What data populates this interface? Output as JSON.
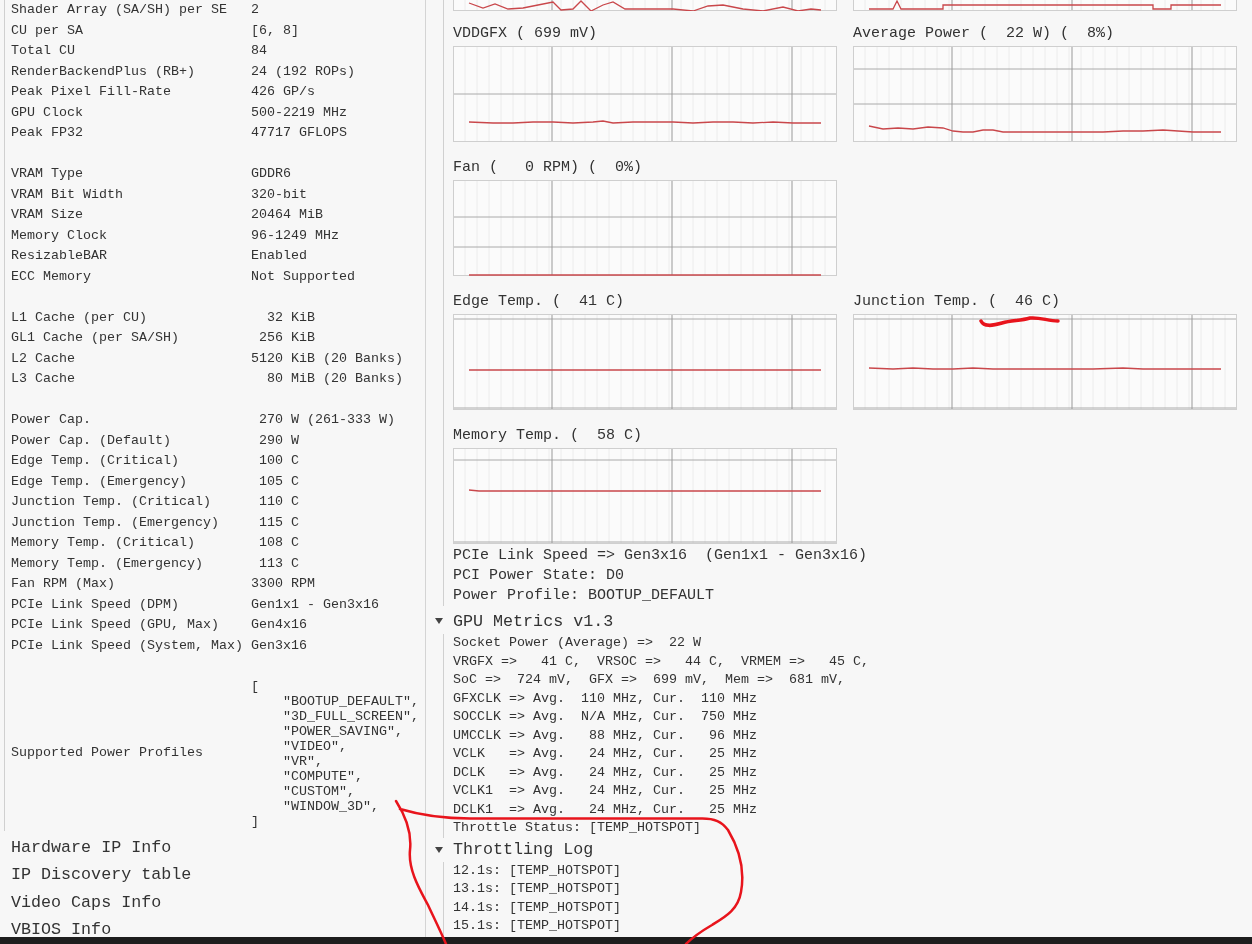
{
  "left_panel": {
    "groups": [
      [
        {
          "label": "Shader Array (SA/SH) per SE",
          "value": "2"
        },
        {
          "label": "CU per SA",
          "value": "[6, 8]"
        },
        {
          "label": "Total CU",
          "value": "84"
        },
        {
          "label": "RenderBackendPlus (RB+)",
          "value": "24 (192 ROPs)"
        },
        {
          "label": "Peak Pixel Fill-Rate",
          "value": "426 GP/s"
        },
        {
          "label": "GPU Clock",
          "value": "500-2219 MHz"
        },
        {
          "label": "Peak FP32",
          "value": "47717 GFLOPS"
        }
      ],
      [
        {
          "label": "VRAM Type",
          "value": "GDDR6"
        },
        {
          "label": "VRAM Bit Width",
          "value": "320-bit"
        },
        {
          "label": "VRAM Size",
          "value": "20464 MiB"
        },
        {
          "label": "Memory Clock",
          "value": "96-1249 MHz"
        },
        {
          "label": "ResizableBAR",
          "value": "Enabled"
        },
        {
          "label": "ECC Memory",
          "value": "Not Supported"
        }
      ],
      [
        {
          "label": "L1 Cache (per CU)",
          "value": "  32 KiB"
        },
        {
          "label": "GL1 Cache (per SA/SH)",
          "value": " 256 KiB"
        },
        {
          "label": "L2 Cache",
          "value": "5120 KiB (20 Banks)"
        },
        {
          "label": "L3 Cache",
          "value": "  80 MiB (20 Banks)"
        }
      ],
      [
        {
          "label": "Power Cap.",
          "value": " 270 W (261-333 W)"
        },
        {
          "label": "Power Cap. (Default)",
          "value": " 290 W"
        },
        {
          "label": "Edge Temp. (Critical)",
          "value": " 100 C"
        },
        {
          "label": "Edge Temp. (Emergency)",
          "value": " 105 C"
        },
        {
          "label": "Junction Temp. (Critical)",
          "value": " 110 C"
        },
        {
          "label": "Junction Temp. (Emergency)",
          "value": " 115 C"
        },
        {
          "label": "Memory Temp. (Critical)",
          "value": " 108 C"
        },
        {
          "label": "Memory Temp. (Emergency)",
          "value": " 113 C"
        },
        {
          "label": "Fan RPM (Max)",
          "value": "3300 RPM"
        },
        {
          "label": "PCIe Link Speed (DPM)",
          "value": "Gen1x1 - Gen3x16"
        },
        {
          "label": "PCIe Link Speed (GPU, Max)",
          "value": "Gen4x16"
        },
        {
          "label": "PCIe Link Speed (System, Max)",
          "value": "Gen3x16"
        }
      ]
    ],
    "power_profiles": {
      "label": "Supported Power Profiles",
      "open": "[",
      "items": [
        "\"BOOTUP_DEFAULT\",",
        "\"3D_FULL_SCREEN\",",
        "\"POWER_SAVING\",",
        "\"VIDEO\",",
        "\"VR\",",
        "\"COMPUTE\",",
        "\"CUSTOM\",",
        "\"WINDOW_3D\","
      ],
      "close": "]"
    }
  },
  "left_sections": [
    {
      "title": "Hardware IP Info"
    },
    {
      "title": "IP Discovery table"
    },
    {
      "title": "Video Caps Info"
    },
    {
      "title": "VBIOS Info"
    }
  ],
  "charts": [
    {
      "kind": "partial"
    },
    {
      "kind": "partial"
    },
    {
      "kind": "chart",
      "title": "VDDGFX ( 699 mV)"
    },
    {
      "kind": "chart",
      "title": "Average Power (  22 W) (  8%)"
    },
    {
      "kind": "chart",
      "title": "Fan (   0 RPM) (  0%)"
    },
    {
      "kind": "blank"
    },
    {
      "kind": "chart",
      "title": "Edge Temp. (  41 C)"
    },
    {
      "kind": "chart",
      "title": "Junction Temp. (  46 C)"
    },
    {
      "kind": "chart",
      "title": "Memory Temp. (  58 C)"
    }
  ],
  "link_info": [
    "PCIe Link Speed => Gen3x16  (Gen1x1 - Gen3x16)",
    "PCI Power State: D0",
    "Power Profile: BOOTUP_DEFAULT"
  ],
  "sections": [
    {
      "title": "GPU Metrics v1.3",
      "expanded": true,
      "lines": [
        "Socket Power (Average) =>  22 W",
        "VRGFX =>   41 C,  VRSOC =>   44 C,  VRMEM =>   45 C,",
        "SoC =>  724 mV,  GFX =>  699 mV,  Mem =>  681 mV,",
        "GFXCLK => Avg.  110 MHz, Cur.  110 MHz",
        "SOCCLK => Avg.  N/A MHz, Cur.  750 MHz",
        "UMCCLK => Avg.   88 MHz, Cur.   96 MHz",
        "VCLK   => Avg.   24 MHz, Cur.   25 MHz",
        "DCLK   => Avg.   24 MHz, Cur.   25 MHz",
        "VCLK1  => Avg.   24 MHz, Cur.   25 MHz",
        "DCLK1  => Avg.   24 MHz, Cur.   25 MHz",
        "Throttle Status: [TEMP_HOTSPOT]"
      ]
    },
    {
      "title": "Throttling Log",
      "expanded": true,
      "lines": [
        "12.1s: [TEMP_HOTSPOT]",
        "13.1s: [TEMP_HOTSPOT]",
        "14.1s: [TEMP_HOTSPOT]",
        "15.1s: [TEMP_HOTSPOT]"
      ]
    }
  ]
}
